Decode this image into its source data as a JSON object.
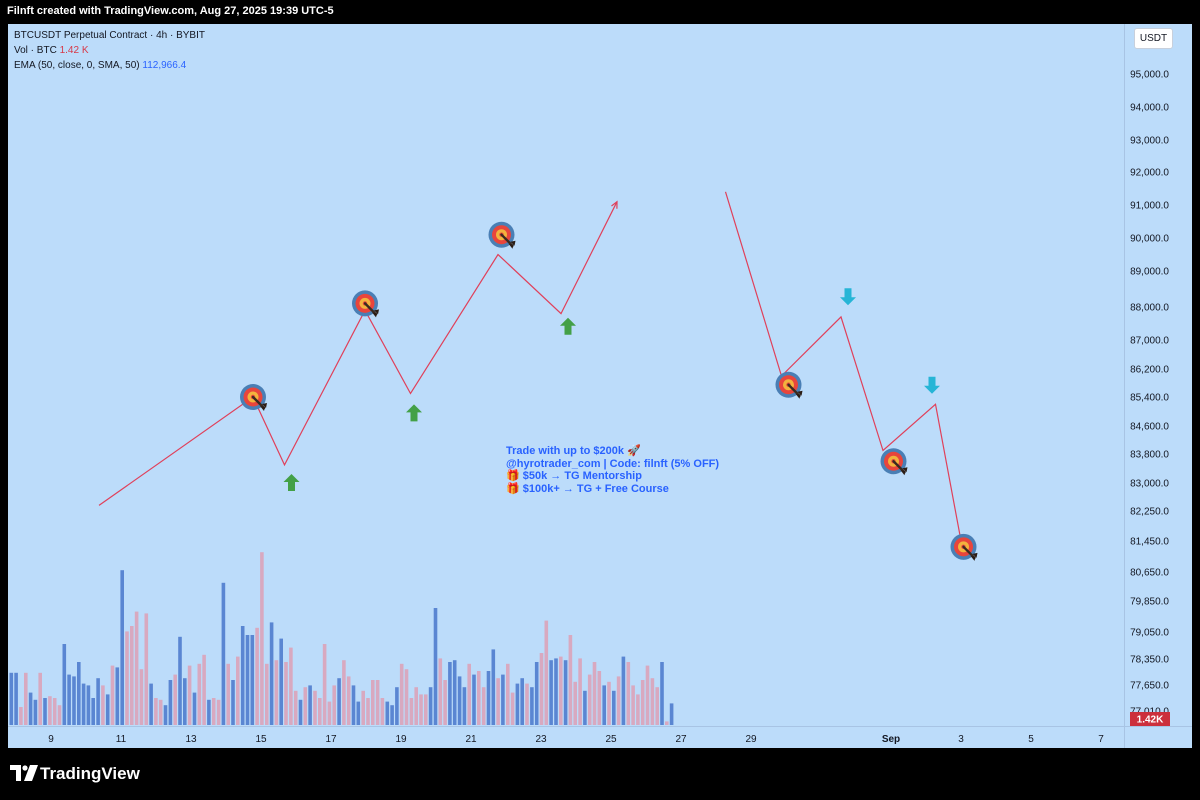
{
  "header": {
    "title": "Filnft created with TradingView.com, Aug 27, 2025 19:39 UTC-5"
  },
  "legend": {
    "symbol": "BTCUSDT Perpetual Contract · 4h · BYBIT",
    "vol_label": "Vol · BTC",
    "vol_value": "1.42 K",
    "ema_label": "EMA (50, close, 0, SMA, 50)",
    "ema_value": "112,966.4"
  },
  "unit_badge": "USDT",
  "price_axis": {
    "ticks": [
      "95,000.0",
      "94,000.0",
      "93,000.0",
      "92,000.0",
      "91,000.0",
      "90,000.0",
      "89,000.0",
      "88,000.0",
      "87,000.0",
      "86,200.0",
      "85,400.0",
      "84,600.0",
      "83,800.0",
      "83,000.0",
      "82,250.0",
      "81,450.0",
      "80,650.0",
      "79,850.0",
      "79,050.0",
      "78,350.0",
      "77,650.0",
      "77,010.0"
    ],
    "volume_badge": "1.42K"
  },
  "time_axis": {
    "ticks": [
      "9",
      "11",
      "13",
      "15",
      "17",
      "19",
      "21",
      "23",
      "25",
      "27",
      "29",
      "Sep",
      "3",
      "5",
      "7"
    ]
  },
  "annotation": {
    "line1": "Trade with up to $200k 🚀",
    "line2": "@hyrotrader_com | Code: filnft (5% OFF)",
    "line3": "🎁 $50k → TG Mentorship",
    "line4": "🎁 $100k+ → TG + Free Course"
  },
  "footer": {
    "brand": "TradingView"
  },
  "colors": {
    "background": "#bcdcfa",
    "path": "#e0405a",
    "volume_up": "#5a86d2",
    "volume_down": "#d8a9c0",
    "up_arrow": "#43a047",
    "down_arrow": "#26b5d6",
    "target_outer": "#4a7fb5",
    "target_mid": "#e8453c",
    "target_inner": "#f2b33d"
  },
  "chart_data": {
    "type": "line",
    "title": "BTCUSDT Perpetual Contract · 4h · BYBIT",
    "ylabel": "USDT",
    "ylim": [
      76800,
      95600
    ],
    "x_ticks": [
      "9",
      "11",
      "13",
      "15",
      "17",
      "19",
      "21",
      "23",
      "25",
      "27",
      "29",
      "Sep",
      "3",
      "5",
      "7"
    ],
    "series": [
      {
        "name": "segment-1",
        "points": [
          [
            10.4,
            82400
          ],
          [
            14.8,
            85400
          ],
          [
            15.7,
            83500
          ],
          [
            18.0,
            87900
          ],
          [
            19.3,
            85500
          ],
          [
            21.8,
            89500
          ],
          [
            23.6,
            87800
          ],
          [
            25.2,
            91100
          ]
        ]
      },
      {
        "name": "segment-2",
        "points": [
          [
            28.3,
            91400
          ],
          [
            29.9,
            86000
          ],
          [
            31.6,
            87700
          ],
          [
            32.8,
            83900
          ],
          [
            34.3,
            85200
          ],
          [
            35.0,
            81600
          ]
        ]
      }
    ],
    "targets": [
      [
        14.8,
        85400
      ],
      [
        18.0,
        88100
      ],
      [
        21.9,
        90100
      ],
      [
        30.1,
        85750
      ],
      [
        33.1,
        83600
      ],
      [
        35.1,
        81300
      ]
    ],
    "up_arrows": [
      [
        15.9,
        83000
      ],
      [
        19.4,
        84950
      ],
      [
        23.8,
        87400
      ]
    ],
    "down_arrows": [
      [
        31.8,
        88300
      ],
      [
        34.2,
        85750
      ]
    ],
    "volume": {
      "unit": "BTC",
      "last": "1.42K",
      "bars": [
        [
          0.29,
          "up"
        ],
        [
          0.29,
          "up"
        ],
        [
          0.1,
          "down"
        ],
        [
          0.29,
          "down"
        ],
        [
          0.18,
          "up"
        ],
        [
          0.14,
          "up"
        ],
        [
          0.29,
          "down"
        ],
        [
          0.15,
          "up"
        ],
        [
          0.16,
          "down"
        ],
        [
          0.15,
          "down"
        ],
        [
          0.11,
          "down"
        ],
        [
          0.45,
          "up"
        ],
        [
          0.28,
          "up"
        ],
        [
          0.27,
          "up"
        ],
        [
          0.35,
          "up"
        ],
        [
          0.23,
          "up"
        ],
        [
          0.22,
          "up"
        ],
        [
          0.15,
          "up"
        ],
        [
          0.26,
          "up"
        ],
        [
          0.22,
          "down"
        ],
        [
          0.17,
          "up"
        ],
        [
          0.33,
          "down"
        ],
        [
          0.32,
          "up"
        ],
        [
          0.86,
          "up"
        ],
        [
          0.52,
          "down"
        ],
        [
          0.55,
          "down"
        ],
        [
          0.63,
          "down"
        ],
        [
          0.31,
          "down"
        ],
        [
          0.62,
          "down"
        ],
        [
          0.23,
          "up"
        ],
        [
          0.15,
          "down"
        ],
        [
          0.14,
          "down"
        ],
        [
          0.11,
          "up"
        ],
        [
          0.25,
          "up"
        ],
        [
          0.28,
          "down"
        ],
        [
          0.49,
          "up"
        ],
        [
          0.26,
          "up"
        ],
        [
          0.33,
          "down"
        ],
        [
          0.18,
          "up"
        ],
        [
          0.34,
          "down"
        ],
        [
          0.39,
          "down"
        ],
        [
          0.14,
          "up"
        ],
        [
          0.15,
          "down"
        ],
        [
          0.14,
          "down"
        ],
        [
          0.79,
          "up"
        ],
        [
          0.34,
          "down"
        ],
        [
          0.25,
          "up"
        ],
        [
          0.38,
          "down"
        ],
        [
          0.55,
          "up"
        ],
        [
          0.5,
          "up"
        ],
        [
          0.5,
          "up"
        ],
        [
          0.54,
          "down"
        ],
        [
          0.96,
          "down"
        ],
        [
          0.34,
          "down"
        ],
        [
          0.57,
          "up"
        ],
        [
          0.36,
          "down"
        ],
        [
          0.48,
          "up"
        ],
        [
          0.35,
          "down"
        ],
        [
          0.43,
          "down"
        ],
        [
          0.19,
          "down"
        ],
        [
          0.14,
          "up"
        ],
        [
          0.21,
          "down"
        ],
        [
          0.22,
          "up"
        ],
        [
          0.19,
          "down"
        ],
        [
          0.15,
          "down"
        ],
        [
          0.45,
          "down"
        ],
        [
          0.13,
          "down"
        ],
        [
          0.22,
          "down"
        ],
        [
          0.26,
          "up"
        ],
        [
          0.36,
          "down"
        ],
        [
          0.27,
          "down"
        ],
        [
          0.22,
          "up"
        ],
        [
          0.13,
          "up"
        ],
        [
          0.19,
          "down"
        ],
        [
          0.15,
          "down"
        ],
        [
          0.25,
          "down"
        ],
        [
          0.25,
          "down"
        ],
        [
          0.15,
          "down"
        ],
        [
          0.13,
          "up"
        ],
        [
          0.11,
          "up"
        ],
        [
          0.21,
          "up"
        ],
        [
          0.34,
          "down"
        ],
        [
          0.31,
          "down"
        ],
        [
          0.15,
          "down"
        ],
        [
          0.21,
          "down"
        ],
        [
          0.17,
          "down"
        ],
        [
          0.17,
          "down"
        ],
        [
          0.21,
          "up"
        ],
        [
          0.65,
          "up"
        ],
        [
          0.37,
          "down"
        ],
        [
          0.25,
          "down"
        ],
        [
          0.35,
          "up"
        ],
        [
          0.36,
          "up"
        ],
        [
          0.27,
          "up"
        ],
        [
          0.21,
          "up"
        ],
        [
          0.34,
          "down"
        ],
        [
          0.28,
          "up"
        ],
        [
          0.3,
          "down"
        ],
        [
          0.21,
          "down"
        ],
        [
          0.3,
          "up"
        ],
        [
          0.42,
          "up"
        ],
        [
          0.26,
          "down"
        ],
        [
          0.28,
          "up"
        ],
        [
          0.34,
          "down"
        ],
        [
          0.18,
          "down"
        ],
        [
          0.23,
          "up"
        ],
        [
          0.26,
          "up"
        ],
        [
          0.23,
          "down"
        ],
        [
          0.21,
          "up"
        ],
        [
          0.35,
          "up"
        ],
        [
          0.4,
          "down"
        ],
        [
          0.58,
          "down"
        ],
        [
          0.36,
          "up"
        ],
        [
          0.37,
          "up"
        ],
        [
          0.38,
          "down"
        ],
        [
          0.36,
          "up"
        ],
        [
          0.5,
          "down"
        ],
        [
          0.24,
          "down"
        ],
        [
          0.37,
          "down"
        ],
        [
          0.19,
          "up"
        ],
        [
          0.28,
          "down"
        ],
        [
          0.35,
          "down"
        ],
        [
          0.3,
          "down"
        ],
        [
          0.22,
          "up"
        ],
        [
          0.24,
          "down"
        ],
        [
          0.19,
          "up"
        ],
        [
          0.27,
          "down"
        ],
        [
          0.38,
          "up"
        ],
        [
          0.35,
          "down"
        ],
        [
          0.22,
          "down"
        ],
        [
          0.17,
          "down"
        ],
        [
          0.25,
          "down"
        ],
        [
          0.33,
          "down"
        ],
        [
          0.26,
          "down"
        ],
        [
          0.21,
          "down"
        ],
        [
          0.35,
          "up"
        ],
        [
          0.02,
          "down"
        ],
        [
          0.12,
          "up"
        ]
      ]
    }
  }
}
